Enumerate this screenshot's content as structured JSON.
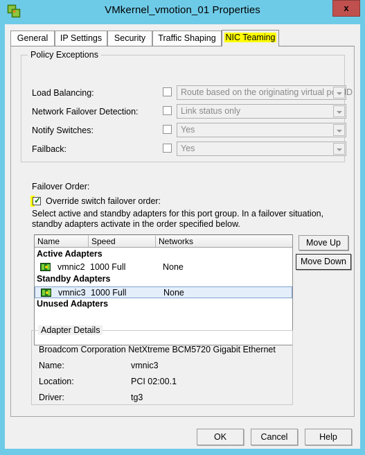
{
  "window": {
    "title": "VMkernel_vmotion_01 Properties",
    "icon": "network-portgroup-icon",
    "close_label": "x",
    "titlebar_color": "#6ecbe8",
    "close_color": "#c0504d"
  },
  "tabs": [
    {
      "label": "General",
      "selected": false,
      "highlighted": false
    },
    {
      "label": "IP Settings",
      "selected": false,
      "highlighted": false
    },
    {
      "label": "Security",
      "selected": false,
      "highlighted": false
    },
    {
      "label": "Traffic Shaping",
      "selected": false,
      "highlighted": false
    },
    {
      "label": "NIC Teaming",
      "selected": true,
      "highlighted": true
    }
  ],
  "policy_exceptions": {
    "group_label": "Policy Exceptions",
    "rows": [
      {
        "label": "Load Balancing:",
        "checked": false,
        "value": "Route based on the originating virtual port ID"
      },
      {
        "label": "Network Failover Detection:",
        "checked": false,
        "value": "Link status only"
      },
      {
        "label": "Notify Switches:",
        "checked": false,
        "value": "Yes"
      },
      {
        "label": "Failback:",
        "checked": false,
        "value": "Yes"
      }
    ]
  },
  "failover": {
    "heading": "Failover Order:",
    "override_label": "Override switch failover order:",
    "override_checked": true,
    "override_highlight_color": "#ffff00",
    "description": "Select active and standby adapters for this port group.  In a failover situation, standby adapters activate  in the order specified below."
  },
  "adapter_list": {
    "columns": [
      "Name",
      "Speed",
      "Networks"
    ],
    "groups": [
      {
        "title": "Active Adapters",
        "adapters": [
          {
            "name": "vmnic2",
            "speed": "1000 Full",
            "networks": "None",
            "selected": false
          }
        ]
      },
      {
        "title": "Standby Adapters",
        "adapters": [
          {
            "name": "vmnic3",
            "speed": "1000 Full",
            "networks": "None",
            "selected": true
          }
        ]
      },
      {
        "title": "Unused Adapters",
        "adapters": []
      }
    ]
  },
  "order_buttons": {
    "move_up": "Move Up",
    "move_down": "Move Down"
  },
  "adapter_details": {
    "group_label": "Adapter Details",
    "device": "Broadcom Corporation NetXtreme BCM5720 Gigabit Ethernet",
    "fields": [
      {
        "label": "Name:",
        "value": "vmnic3"
      },
      {
        "label": "Location:",
        "value": "PCI 02:00.1"
      },
      {
        "label": "Driver:",
        "value": "tg3"
      }
    ]
  },
  "footer": {
    "ok": "OK",
    "cancel": "Cancel",
    "help": "Help"
  }
}
